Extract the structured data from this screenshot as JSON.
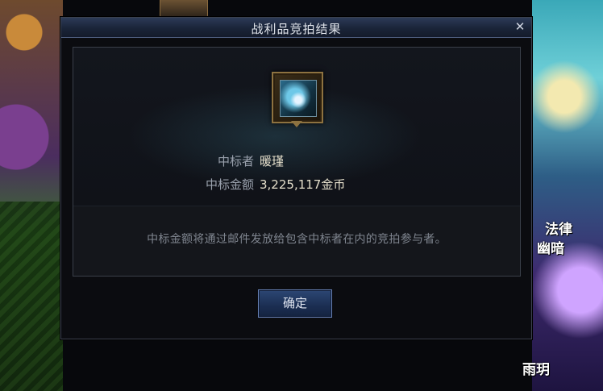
{
  "dialog": {
    "title": "战利品竞拍结果",
    "close_glyph": "✕"
  },
  "item": {
    "icon": "equipment-item-icon"
  },
  "result": {
    "winner_label": "中标者",
    "winner_value": "暖瑾",
    "amount_label": "中标金额",
    "amount_value": "3,225,117金币"
  },
  "notice": "中标金额将通过邮件发放给包含中标者在内的竞拍参与者。",
  "buttons": {
    "confirm": "确定"
  },
  "background": {
    "right_text_1": "法律",
    "right_text_2": "幽暗",
    "right_text_3": "雨玥"
  },
  "colors": {
    "title_bar": "#1a2438",
    "button": "#1b2e52",
    "value_text": "#e6e0cc",
    "label_text": "#9aa1ad"
  }
}
